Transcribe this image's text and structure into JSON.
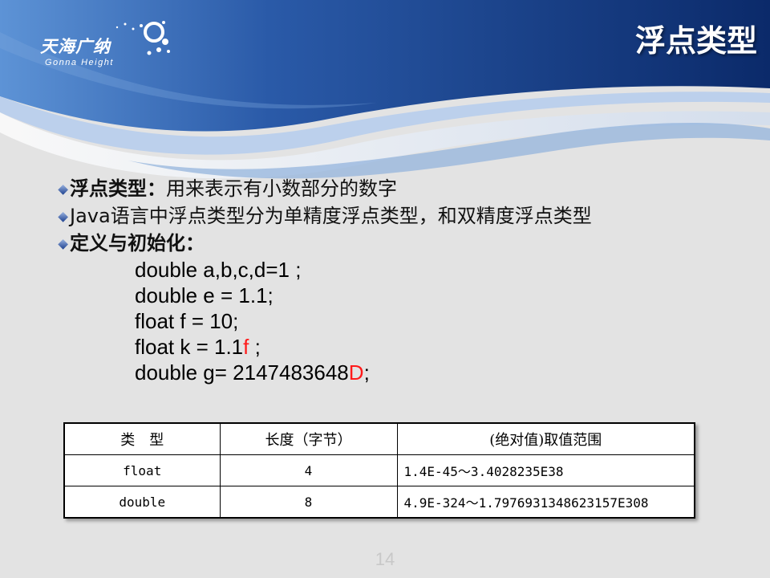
{
  "header": {
    "logo_text": "天海广纳",
    "logo_subtext": "Gonna Height",
    "title": "浮点类型"
  },
  "bullets": [
    {
      "bold": "浮点类型：",
      "text": "用来表示有小数部分的数字"
    },
    {
      "bold": "",
      "text": "Java语言中浮点类型分为单精度浮点类型，和双精度浮点类型"
    },
    {
      "bold": "定义与初始化：",
      "text": ""
    }
  ],
  "code": [
    {
      "before": "double a,b,c,d=1 ;",
      "highlight": "",
      "after": ""
    },
    {
      "before": "double e = 1.1;",
      "highlight": "",
      "after": ""
    },
    {
      "before": "float f = 10;",
      "highlight": "",
      "after": ""
    },
    {
      "before": "float k = 1.1",
      "highlight": "f",
      "after": " ;"
    },
    {
      "before": "double g= 2147483648",
      "highlight": "D",
      "after": ";"
    }
  ],
  "table": {
    "headers": [
      "类　型",
      "长度（字节）",
      "(绝对值)取值范围"
    ],
    "rows": [
      [
        "float",
        "4",
        "1.4E-45～3.4028235E38"
      ],
      [
        "double",
        "8",
        "4.9E-324～1.7976931348623157E308"
      ]
    ]
  },
  "page_number": "14",
  "colors": {
    "header_dark": "#0d2d6e",
    "header_mid": "#2f63b4",
    "highlight_red": "#ff1a1a",
    "background": "#e3e3e3"
  }
}
